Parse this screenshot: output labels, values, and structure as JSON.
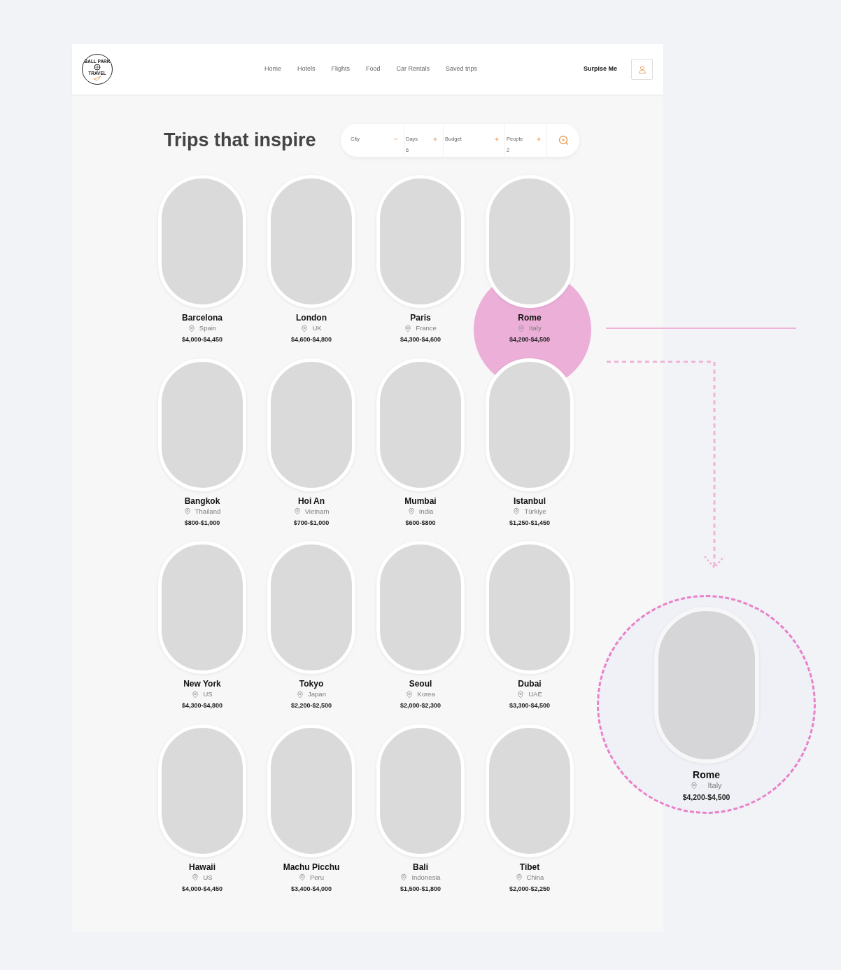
{
  "logo": {
    "top": "BALL PARK",
    "bottom": "TRAVEL"
  },
  "nav": [
    "Home",
    "Hotels",
    "Flights",
    "Food",
    "Car Rentals",
    "Saved trips"
  ],
  "surprise_button": "Surpise Me",
  "title": "Trips that inspire",
  "search": [
    {
      "kind": "select",
      "label": "City"
    },
    {
      "kind": "counter",
      "label": "Days",
      "value": "6"
    },
    {
      "kind": "counter",
      "label": "Budget"
    },
    {
      "kind": "counter",
      "label": "People",
      "value": "2"
    }
  ],
  "trips": [
    {
      "name": "Barcelona",
      "country": "Spain",
      "price": "$4,000-$4,450",
      "highlighted": false
    },
    {
      "name": "London",
      "country": "UK",
      "price": "$4,600-$4,800",
      "highlighted": false
    },
    {
      "name": "Paris",
      "country": "France",
      "price": "$4,300-$4,600",
      "highlighted": false
    },
    {
      "name": "Rome",
      "country": "Italy",
      "price": "$4,200-$4,500",
      "highlighted": true
    },
    {
      "name": "Bangkok",
      "country": "Thailand",
      "price": "$800-$1,000",
      "highlighted": false
    },
    {
      "name": "Hoi An",
      "country": "Vietnam",
      "price": "$700-$1,000",
      "highlighted": false
    },
    {
      "name": "Mumbai",
      "country": "India",
      "price": "$600-$800",
      "highlighted": false
    },
    {
      "name": "Istanbul",
      "country": "Türkiye",
      "price": "$1,250-$1,450",
      "highlighted": false
    },
    {
      "name": "New York",
      "country": "US",
      "price": "$4,300-$4,800",
      "highlighted": false
    },
    {
      "name": "Tokyo",
      "country": "Japan",
      "price": "$2,200-$2,500",
      "highlighted": false
    },
    {
      "name": "Seoul",
      "country": "Korea",
      "price": "$2,000-$2,300",
      "highlighted": false
    },
    {
      "name": "Dubai",
      "country": "UAE",
      "price": "$3,300-$4,500",
      "highlighted": false
    },
    {
      "name": "Hawaii",
      "country": "US",
      "price": "$4,000-$4,450",
      "highlighted": false
    },
    {
      "name": "Machu Picchu",
      "country": "Peru",
      "price": "$3,400-$4,000",
      "highlighted": false
    },
    {
      "name": "Bali",
      "country": "Indonesia",
      "price": "$1,500-$1,800",
      "highlighted": false
    },
    {
      "name": "Tibet",
      "country": "China",
      "price": "$2,000-$2,250",
      "highlighted": false
    }
  ],
  "callout": {
    "name": "Rome",
    "country": "Italy",
    "price": "$4,200-$4,500"
  }
}
